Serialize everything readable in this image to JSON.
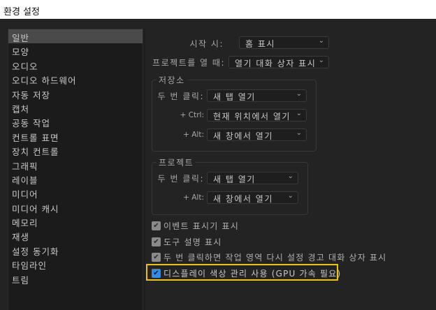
{
  "window": {
    "title": "환경 설정"
  },
  "sidebar": {
    "items": [
      "일반",
      "모양",
      "오디오",
      "오디오 하드웨어",
      "자동 저장",
      "캡처",
      "공동 작업",
      "컨트롤 표면",
      "장치 컨트롤",
      "그래픽",
      "레이블",
      "미디어",
      "미디어 캐시",
      "메모리",
      "재생",
      "설정 동기화",
      "타임라인",
      "트림"
    ],
    "selected": "일반"
  },
  "general": {
    "startup_label": "시작 시:",
    "startup_value": "홈 표시",
    "open_project_label": "프로젝트를 열 때:",
    "open_project_value": "열기 대화 상자 표시",
    "bin": {
      "title": "저장소",
      "double_click_label": "두 번 클릭:",
      "double_click_value": "새 탭 열기",
      "ctrl_label": "+ Ctrl:",
      "ctrl_value": "현재 위치에서 열기",
      "alt_label": "+ Alt:",
      "alt_value": "새 창에서 열기"
    },
    "project": {
      "title": "프로젝트",
      "double_click_label": "두 번 클릭:",
      "double_click_value": "새 탭 열기",
      "alt_label": "+ Alt:",
      "alt_value": "새 창에서 열기"
    },
    "checkboxes": [
      {
        "label": "이벤트 표시기 표시",
        "checked": true
      },
      {
        "label": "도구 설명 표시",
        "checked": true
      },
      {
        "label": "두 번 클릭하면 작업 영역 다시 설정 경고 대화 상자 표시",
        "checked": true
      },
      {
        "label": "디스플레이 색상 관리 사용 (GPU 가속 필요)",
        "checked": true
      }
    ],
    "highlight_color": "#f2c200"
  }
}
